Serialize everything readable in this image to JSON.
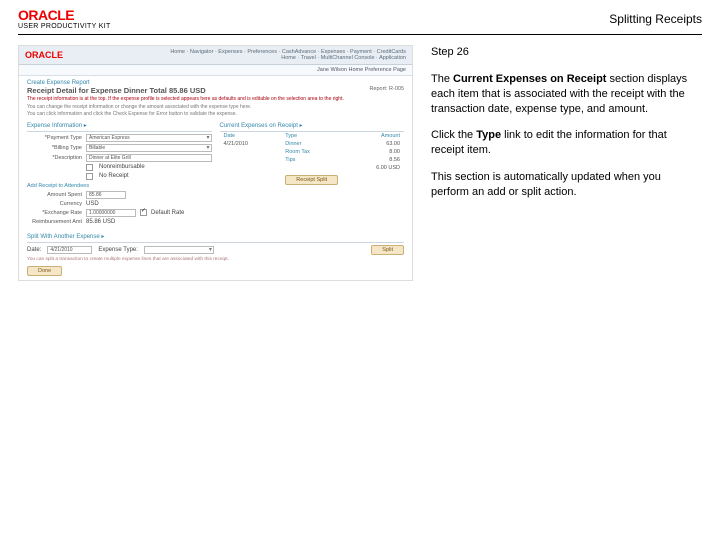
{
  "header": {
    "logo_main": "ORACLE",
    "logo_sub": "USER PRODUCTIVITY KIT",
    "title": "Splitting Receipts"
  },
  "right": {
    "step": "Step 26",
    "p1a": "The ",
    "p1b": "Current Expenses on Receipt",
    "p1c": " section displays each item that is associated with the receipt with the transaction date, expense type, and amount.",
    "p2a": "Click the ",
    "p2b": "Type",
    "p2c": " link to edit the information for that receipt item.",
    "p3": "This section is automatically updated when you perform an add or split action."
  },
  "shot": {
    "oracle": "ORACLE",
    "top_right_line1": "Home · Navigator · Expenses · Preferences · CashAdvance · Expenses · Payment · CreditCards",
    "top_right_line2": "Home · Travel · MultiChannel Console · Application",
    "submenu": "Jane Wilson  Home  Preference Page",
    "crumb": "Create Expense Report",
    "title": "Receipt Detail for Expense Dinner  Total 85.86 USD",
    "report_label": "Report:  R-005",
    "blurb1": "The receipt information is at the top. If the expense profile is selected appears here as defaults and is editable on the selection area to the right.",
    "blurb2": "You can change the receipt information or change the amount associated with the expense type here.",
    "blurb3": "You can click information and click the Check Expense for Error button to validate the expense.",
    "sec_left": "Expense Information  ▸",
    "sec_right": "Current Expenses on Receipt  ▸",
    "form": {
      "payment_type_lbl": "*Payment Type",
      "payment_type_val": "American Express",
      "billing_type_lbl": "*Billing Type",
      "billing_type_val": "Billable",
      "description_lbl": "*Description",
      "description_val": "Dinner at Elite Grill",
      "nonreimb_lbl": "Nonreimbursable",
      "nolreceipt_lbl": "No Receipt",
      "sub_h": "Add Receipt to Attendees",
      "amount_spent_lbl": "Amount Spent",
      "amount_spent_val": "85.86",
      "currency_lbl": "Currency",
      "currency_val": "USD",
      "exchange_lbl": "*Exchange Rate",
      "exchange_val": "1.00000000",
      "default_rate_lbl": "Default Rate",
      "reimburse_lbl": "Reimbursement Amt",
      "reimburse_val": "85.86  USD"
    },
    "table": {
      "h1": "Date",
      "h2": "Type",
      "h3": "Amount",
      "rows": [
        {
          "date": "4/21/2010",
          "type": "Dinner",
          "amt": "63.00"
        },
        {
          "date": "",
          "type": "Room Tax",
          "amt": "8.00"
        },
        {
          "date": "",
          "type": "Tips",
          "amt": "8.56"
        },
        {
          "date": "",
          "type": "",
          "amt": "6.00  USD"
        }
      ]
    },
    "btn_receipt_split": "Receipt Split",
    "btn_split": "Split",
    "foot_h": "Split With Another Expense  ▸",
    "foot_date_lbl": "Date:",
    "foot_date_val": "4/21/2010",
    "foot_type_lbl": "Expense Type:",
    "foot_note": "You can split a transaction to create multiple expense lines that are associated with this receipt.",
    "done": "Done"
  }
}
